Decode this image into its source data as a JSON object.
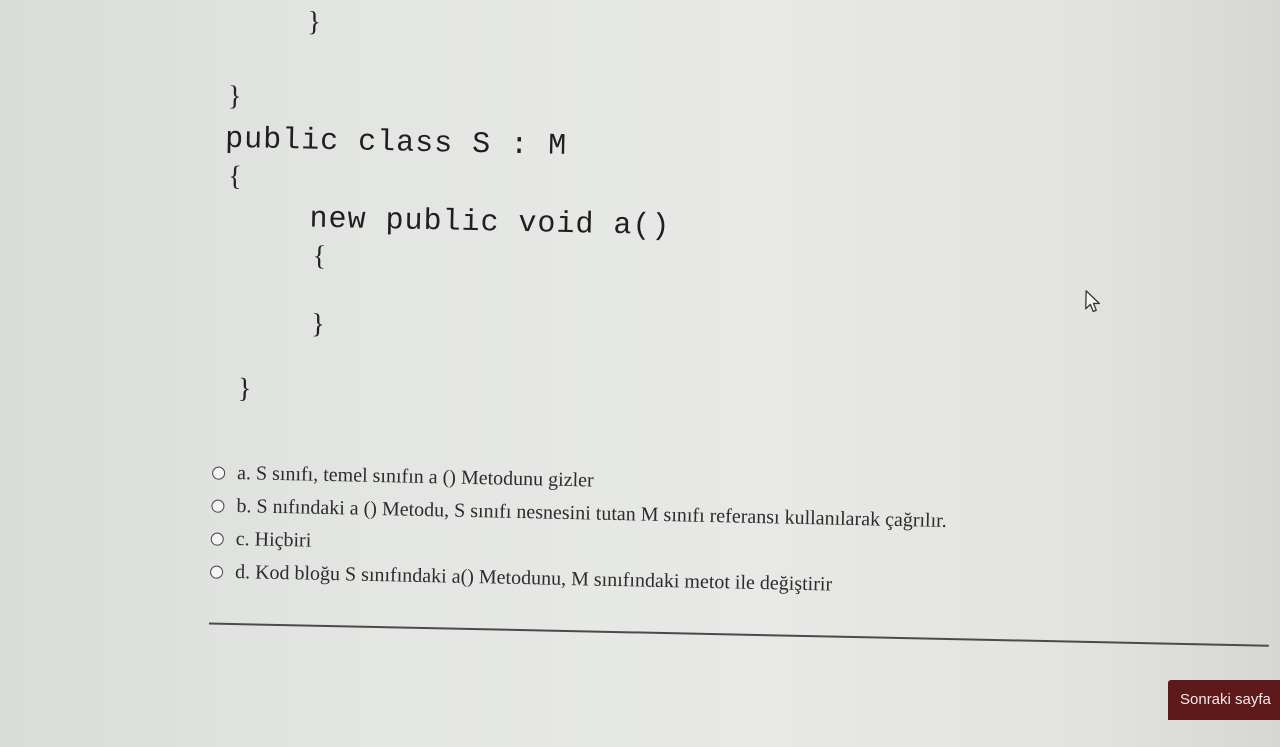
{
  "code": {
    "line_close_method_1": "}",
    "line_close_class_m": "}",
    "line_class_decl": "public class S : M",
    "line_open_class_s": "{",
    "line_method_decl": "new public void a()",
    "line_open_method_2": "{",
    "line_close_method_2": "}",
    "line_close_class_s": "}"
  },
  "question": {
    "options": [
      {
        "label": "a. S sınıfı, temel sınıfın a () Metodunu gizler",
        "selected": false
      },
      {
        "label": "b. S nıfındaki a () Metodu, S sınıfı nesnesini tutan M sınıfı referansı kullanılarak çağrılır.",
        "selected": false
      },
      {
        "label": "c. Hiçbiri",
        "selected": false
      },
      {
        "label": "d. Kod bloğu S sınıfındaki a() Metodunu, M sınıfındaki metot ile değiştirir",
        "selected": false
      }
    ]
  },
  "navigation": {
    "next_label": "Sonraki sayfa"
  },
  "colors": {
    "next_button_bg": "#5e1a1a",
    "page_bg": "#e6e7e4"
  }
}
